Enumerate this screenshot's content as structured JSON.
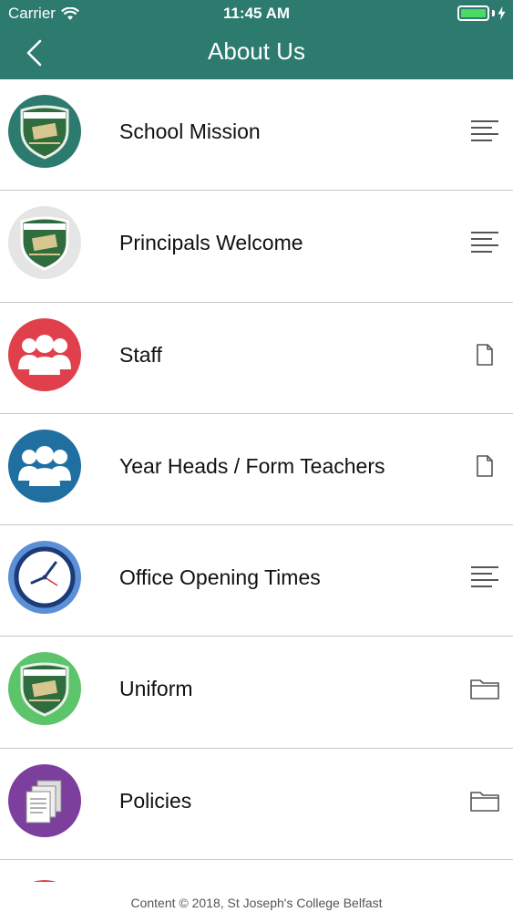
{
  "status_bar": {
    "carrier": "Carrier",
    "time": "11:45 AM",
    "battery_level": 1.0,
    "battery_color": "#4cd964"
  },
  "nav": {
    "title": "About Us",
    "back_icon": "chevron-left-icon",
    "color": "#2d7a6f"
  },
  "items": [
    {
      "label": "School Mission",
      "icon": "crest-icon",
      "circle_color": "#2d7a6f",
      "accessory": "text-lines-icon"
    },
    {
      "label": "Principals Welcome",
      "icon": "crest-icon",
      "circle_color": "#e5e5e5",
      "accessory": "text-lines-icon"
    },
    {
      "label": "Staff",
      "icon": "group-icon",
      "circle_color": "#e0404b",
      "accessory": "document-icon"
    },
    {
      "label": "Year Heads / Form Teachers",
      "icon": "group-icon",
      "circle_color": "#1f6fa0",
      "accessory": "document-icon"
    },
    {
      "label": "Office Opening Times",
      "icon": "clock-icon",
      "circle_color": "#5b8fd6",
      "accessory": "text-lines-icon"
    },
    {
      "label": "Uniform",
      "icon": "crest-icon",
      "circle_color": "#5cc46a",
      "accessory": "folder-icon"
    },
    {
      "label": "Policies",
      "icon": "documents-stack-icon",
      "circle_color": "#7d3f9e",
      "accessory": "folder-icon"
    }
  ],
  "partial_item": {
    "circle_color": "#e0404b"
  },
  "footer": {
    "text": "Content © 2018, St Joseph's College Belfast"
  }
}
